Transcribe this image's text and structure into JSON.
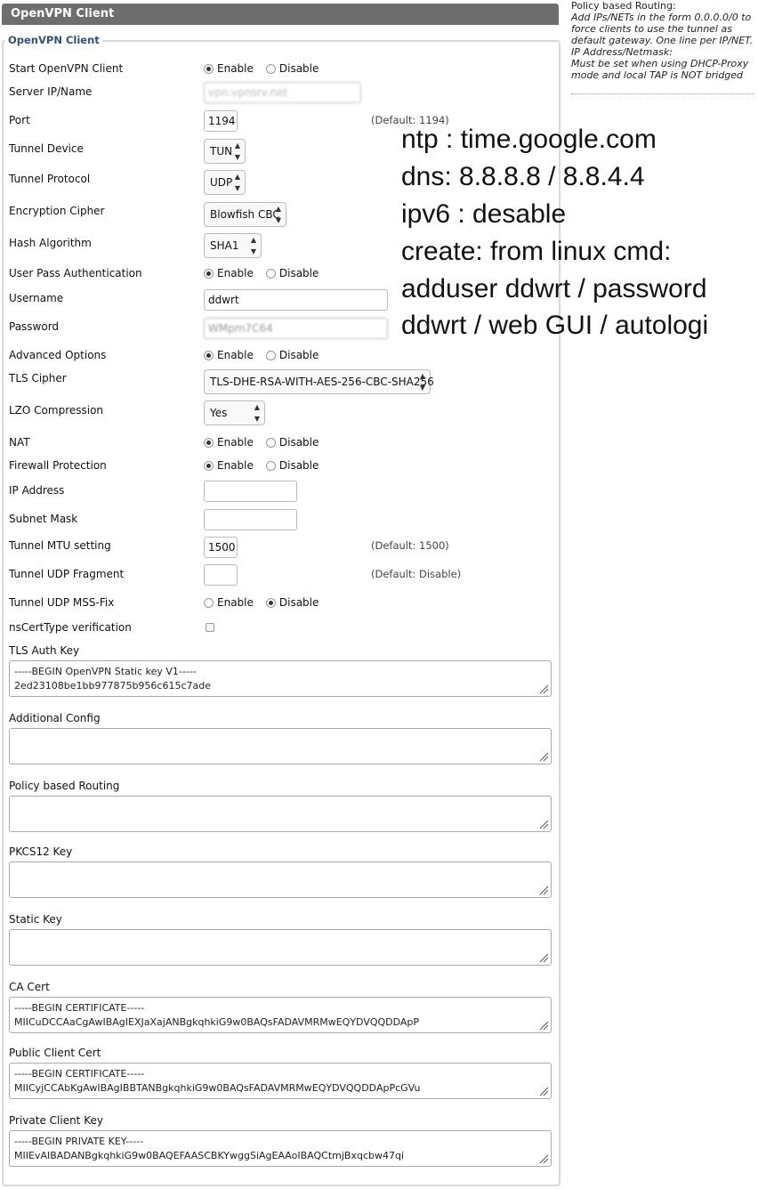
{
  "header": {
    "title": "OpenVPN Client"
  },
  "section": {
    "legend": "OpenVPN Client"
  },
  "radio": {
    "enable": "Enable",
    "disable": "Disable"
  },
  "fields": {
    "start": {
      "label": "Start OpenVPN Client",
      "value": "Enable"
    },
    "server": {
      "label": "Server IP/Name",
      "value": "vpn.vpnsrv.net"
    },
    "port": {
      "label": "Port",
      "value": "1194",
      "default": "(Default: 1194)"
    },
    "tunnel_device": {
      "label": "Tunnel Device",
      "value": "TUN"
    },
    "tunnel_protocol": {
      "label": "Tunnel Protocol",
      "value": "UDP"
    },
    "cipher": {
      "label": "Encryption Cipher",
      "value": "Blowfish CBC"
    },
    "hash": {
      "label": "Hash Algorithm",
      "value": "SHA1"
    },
    "user_pass": {
      "label": "User Pass Authentication",
      "value": "Enable"
    },
    "username": {
      "label": "Username",
      "value": "ddwrt"
    },
    "password": {
      "label": "Password",
      "value": "WMpm7C64"
    },
    "advanced": {
      "label": "Advanced Options",
      "value": "Enable"
    },
    "tls_cipher": {
      "label": "TLS Cipher",
      "value": "TLS-DHE-RSA-WITH-AES-256-CBC-SHA256"
    },
    "lzo": {
      "label": "LZO Compression",
      "value": "Yes"
    },
    "nat": {
      "label": "NAT",
      "value": "Enable"
    },
    "firewall": {
      "label": "Firewall Protection",
      "value": "Enable"
    },
    "ip": {
      "label": "IP Address",
      "value": ""
    },
    "subnet": {
      "label": "Subnet Mask",
      "value": ""
    },
    "mtu": {
      "label": "Tunnel MTU setting",
      "value": "1500",
      "default": "(Default: 1500)"
    },
    "udp_fragment": {
      "label": "Tunnel UDP Fragment",
      "value": "",
      "default": "(Default: Disable)"
    },
    "mss_fix": {
      "label": "Tunnel UDP MSS-Fix",
      "value": "Disable"
    },
    "nscert": {
      "label": "nsCertType verification",
      "checked": false
    }
  },
  "textareas": {
    "tls_auth": {
      "label": "TLS Auth Key",
      "lines": [
        "-----BEGIN OpenVPN Static key V1-----",
        "2ed23108be1bb977875b956c615c7ade"
      ]
    },
    "additional": {
      "label": "Additional Config",
      "lines": []
    },
    "policy": {
      "label": "Policy based Routing",
      "lines": []
    },
    "pkcs12": {
      "label": "PKCS12 Key",
      "lines": []
    },
    "static": {
      "label": "Static Key",
      "lines": []
    },
    "ca": {
      "label": "CA Cert",
      "lines": [
        "-----BEGIN CERTIFICATE-----",
        "MIICuDCCAaCgAwIBAgIEXJaXajANBgkqhkiG9w0BAQsFADAVMRMwEQYDVQQDDApP"
      ]
    },
    "public_cert": {
      "label": "Public Client Cert",
      "lines": [
        "-----BEGIN CERTIFICATE-----",
        "MIICyjCCAbKgAwIBAgIBBTANBgkqhkiG9w0BAQsFADAVMRMwEQYDVQQDDApPcGVu"
      ]
    },
    "private_key": {
      "label": "Private Client Key",
      "lines": [
        "-----BEGIN PRIVATE KEY-----",
        "MIIEvAIBADANBgkqhkiG9w0BAQEFAASCBKYwggSiAgEAAoIBAQCtmjBxqcbw47qi"
      ]
    }
  },
  "help": {
    "title": "Policy based Routing:",
    "body1": "Add IPs/NETs in the form 0.0.0.0/0 to force clients to use the tunnel as default gateway. One line per IP/NET.",
    "title2": "IP Address/Netmask:",
    "body2": "Must be set when using DHCP-Proxy mode and local TAP is NOT bridged"
  },
  "notes": [
    "ntp : time.google.com",
    "dns: 8.8.8.8 / 8.8.4.4",
    "ipv6 : desable",
    "create: from linux cmd:",
    "adduser ddwrt  / password",
    "ddwrt / web GUI / autologi"
  ]
}
